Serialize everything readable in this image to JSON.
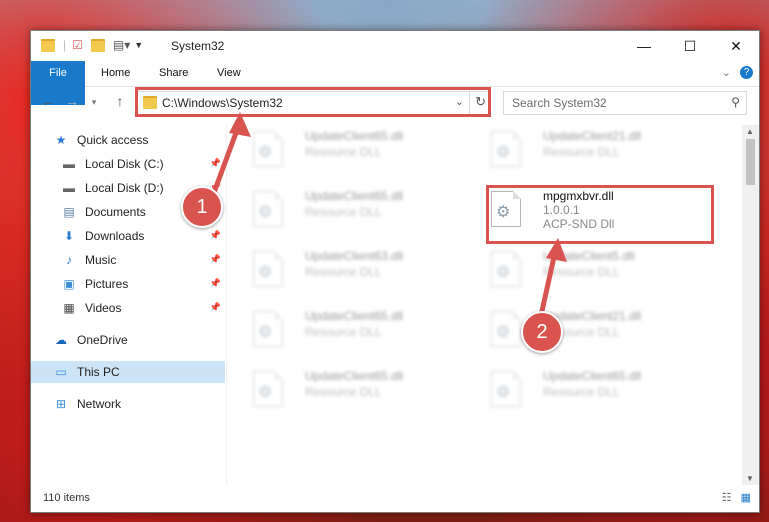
{
  "window": {
    "title": "System32"
  },
  "ribbon": {
    "tabs": [
      "File",
      "Home",
      "Share",
      "View"
    ],
    "help_label": "?"
  },
  "address": {
    "path": "C:\\Windows\\System32"
  },
  "search": {
    "placeholder": "Search System32"
  },
  "sidebar": {
    "items": [
      {
        "label": "Quick access",
        "icon": "star-icon"
      },
      {
        "label": "Local Disk (C:)",
        "icon": "drive-icon"
      },
      {
        "label": "Local Disk (D:)",
        "icon": "drive-icon"
      },
      {
        "label": "Documents",
        "icon": "documents-icon"
      },
      {
        "label": "Downloads",
        "icon": "download-icon"
      },
      {
        "label": "Music",
        "icon": "music-icon"
      },
      {
        "label": "Pictures",
        "icon": "pictures-icon"
      },
      {
        "label": "Videos",
        "icon": "videos-icon"
      },
      {
        "label": "OneDrive",
        "icon": "cloud-icon"
      },
      {
        "label": "This PC",
        "icon": "computer-icon"
      },
      {
        "label": "Network",
        "icon": "network-icon"
      }
    ]
  },
  "files": [
    {
      "name": "UpdateClient65.dll",
      "desc": "Resource DLL"
    },
    {
      "name": "UpdateClient21.dll",
      "desc": "Resource DLL"
    },
    {
      "name": "UpdateClient65.dll",
      "desc": "Resource DLL"
    },
    {
      "name": "mpgmxbvr.dll",
      "version": "1.0.0.1",
      "desc": "ACP-SND Dll"
    },
    {
      "name": "UpdateClient63.dll",
      "desc": "Resource DLL"
    },
    {
      "name": "UpdateClient5.dll",
      "desc": "Resource DLL"
    },
    {
      "name": "UpdateClient65.dll",
      "desc": "Resource DLL"
    },
    {
      "name": "UpdateClient21.dll",
      "desc": "Resource DLL"
    },
    {
      "name": "UpdateClient65.dll",
      "desc": "Resource DLL"
    },
    {
      "name": "UpdateClient65.dll",
      "desc": "Resource DLL"
    }
  ],
  "status": {
    "item_count": "110 items"
  },
  "annotations": {
    "step1": "1",
    "step2": "2"
  },
  "colors": {
    "accent": "#1979ca",
    "highlight": "#d9534f",
    "selected": "#cce4f7"
  }
}
